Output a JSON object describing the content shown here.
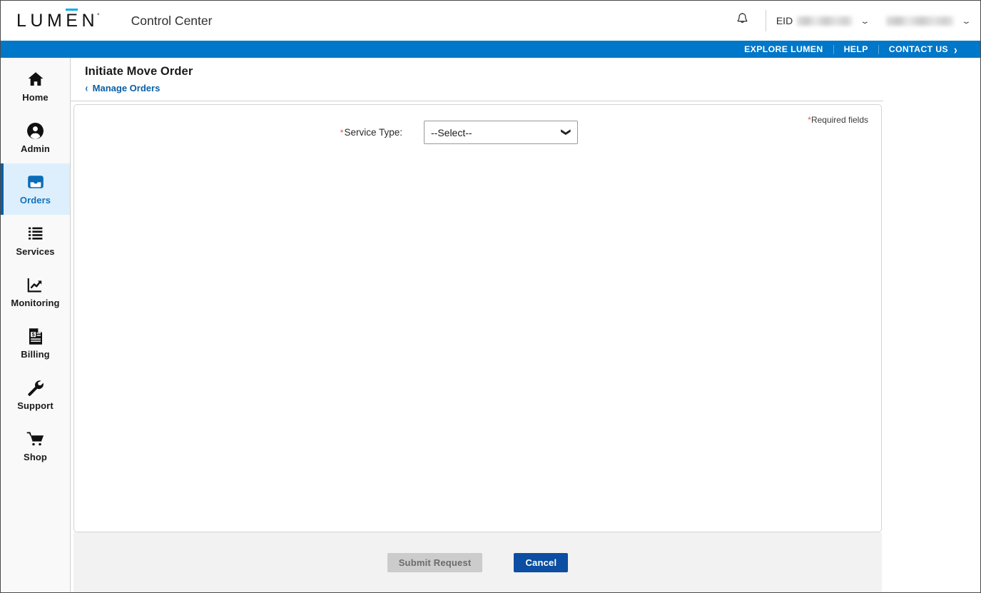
{
  "brand": {
    "logo_part1": "LUM",
    "logo_letter_e": "E",
    "logo_part2": "N",
    "logo_registered": "°",
    "accent_color": "#0aaee6"
  },
  "header": {
    "app_title": "Control Center",
    "bell_icon": "bell-icon",
    "eid_label": "EID",
    "eid_value_masked": "",
    "account_value_masked": "",
    "eid_chevron": "⌄",
    "account_chevron": "⌄"
  },
  "utility_nav": {
    "background_color": "#0077c8",
    "items": [
      {
        "label": "EXPLORE LUMEN"
      },
      {
        "label": "HELP"
      },
      {
        "label": "CONTACT US",
        "arrow": "›"
      }
    ]
  },
  "sidebar": {
    "active_background": "#ddeffc",
    "active_accent": "#0b5fa5",
    "items": [
      {
        "label": "Home",
        "icon": "home-icon",
        "active": false
      },
      {
        "label": "Admin",
        "icon": "user-circle-icon",
        "active": false
      },
      {
        "label": "Orders",
        "icon": "inbox-tray-icon",
        "active": true
      },
      {
        "label": "Services",
        "icon": "list-icon",
        "active": false
      },
      {
        "label": "Monitoring",
        "icon": "chart-trend-icon",
        "active": false
      },
      {
        "label": "Billing",
        "icon": "invoice-dollar-icon",
        "active": false
      },
      {
        "label": "Support",
        "icon": "wrench-icon",
        "active": false
      },
      {
        "label": "Shop",
        "icon": "shopping-cart-icon",
        "active": false
      }
    ]
  },
  "page": {
    "title": "Initiate Move Order",
    "back_link": "Manage Orders",
    "back_chevron": "‹"
  },
  "form": {
    "required_note": "Required fields",
    "required_marker": "*",
    "fields": [
      {
        "label": "Service Type:",
        "required": true,
        "type": "select",
        "value": "--Select--",
        "options": [
          "--Select--"
        ]
      }
    ]
  },
  "footer": {
    "submit_label": "Submit Request",
    "submit_disabled": true,
    "cancel_label": "Cancel",
    "cancel_color": "#0b4ea2"
  }
}
